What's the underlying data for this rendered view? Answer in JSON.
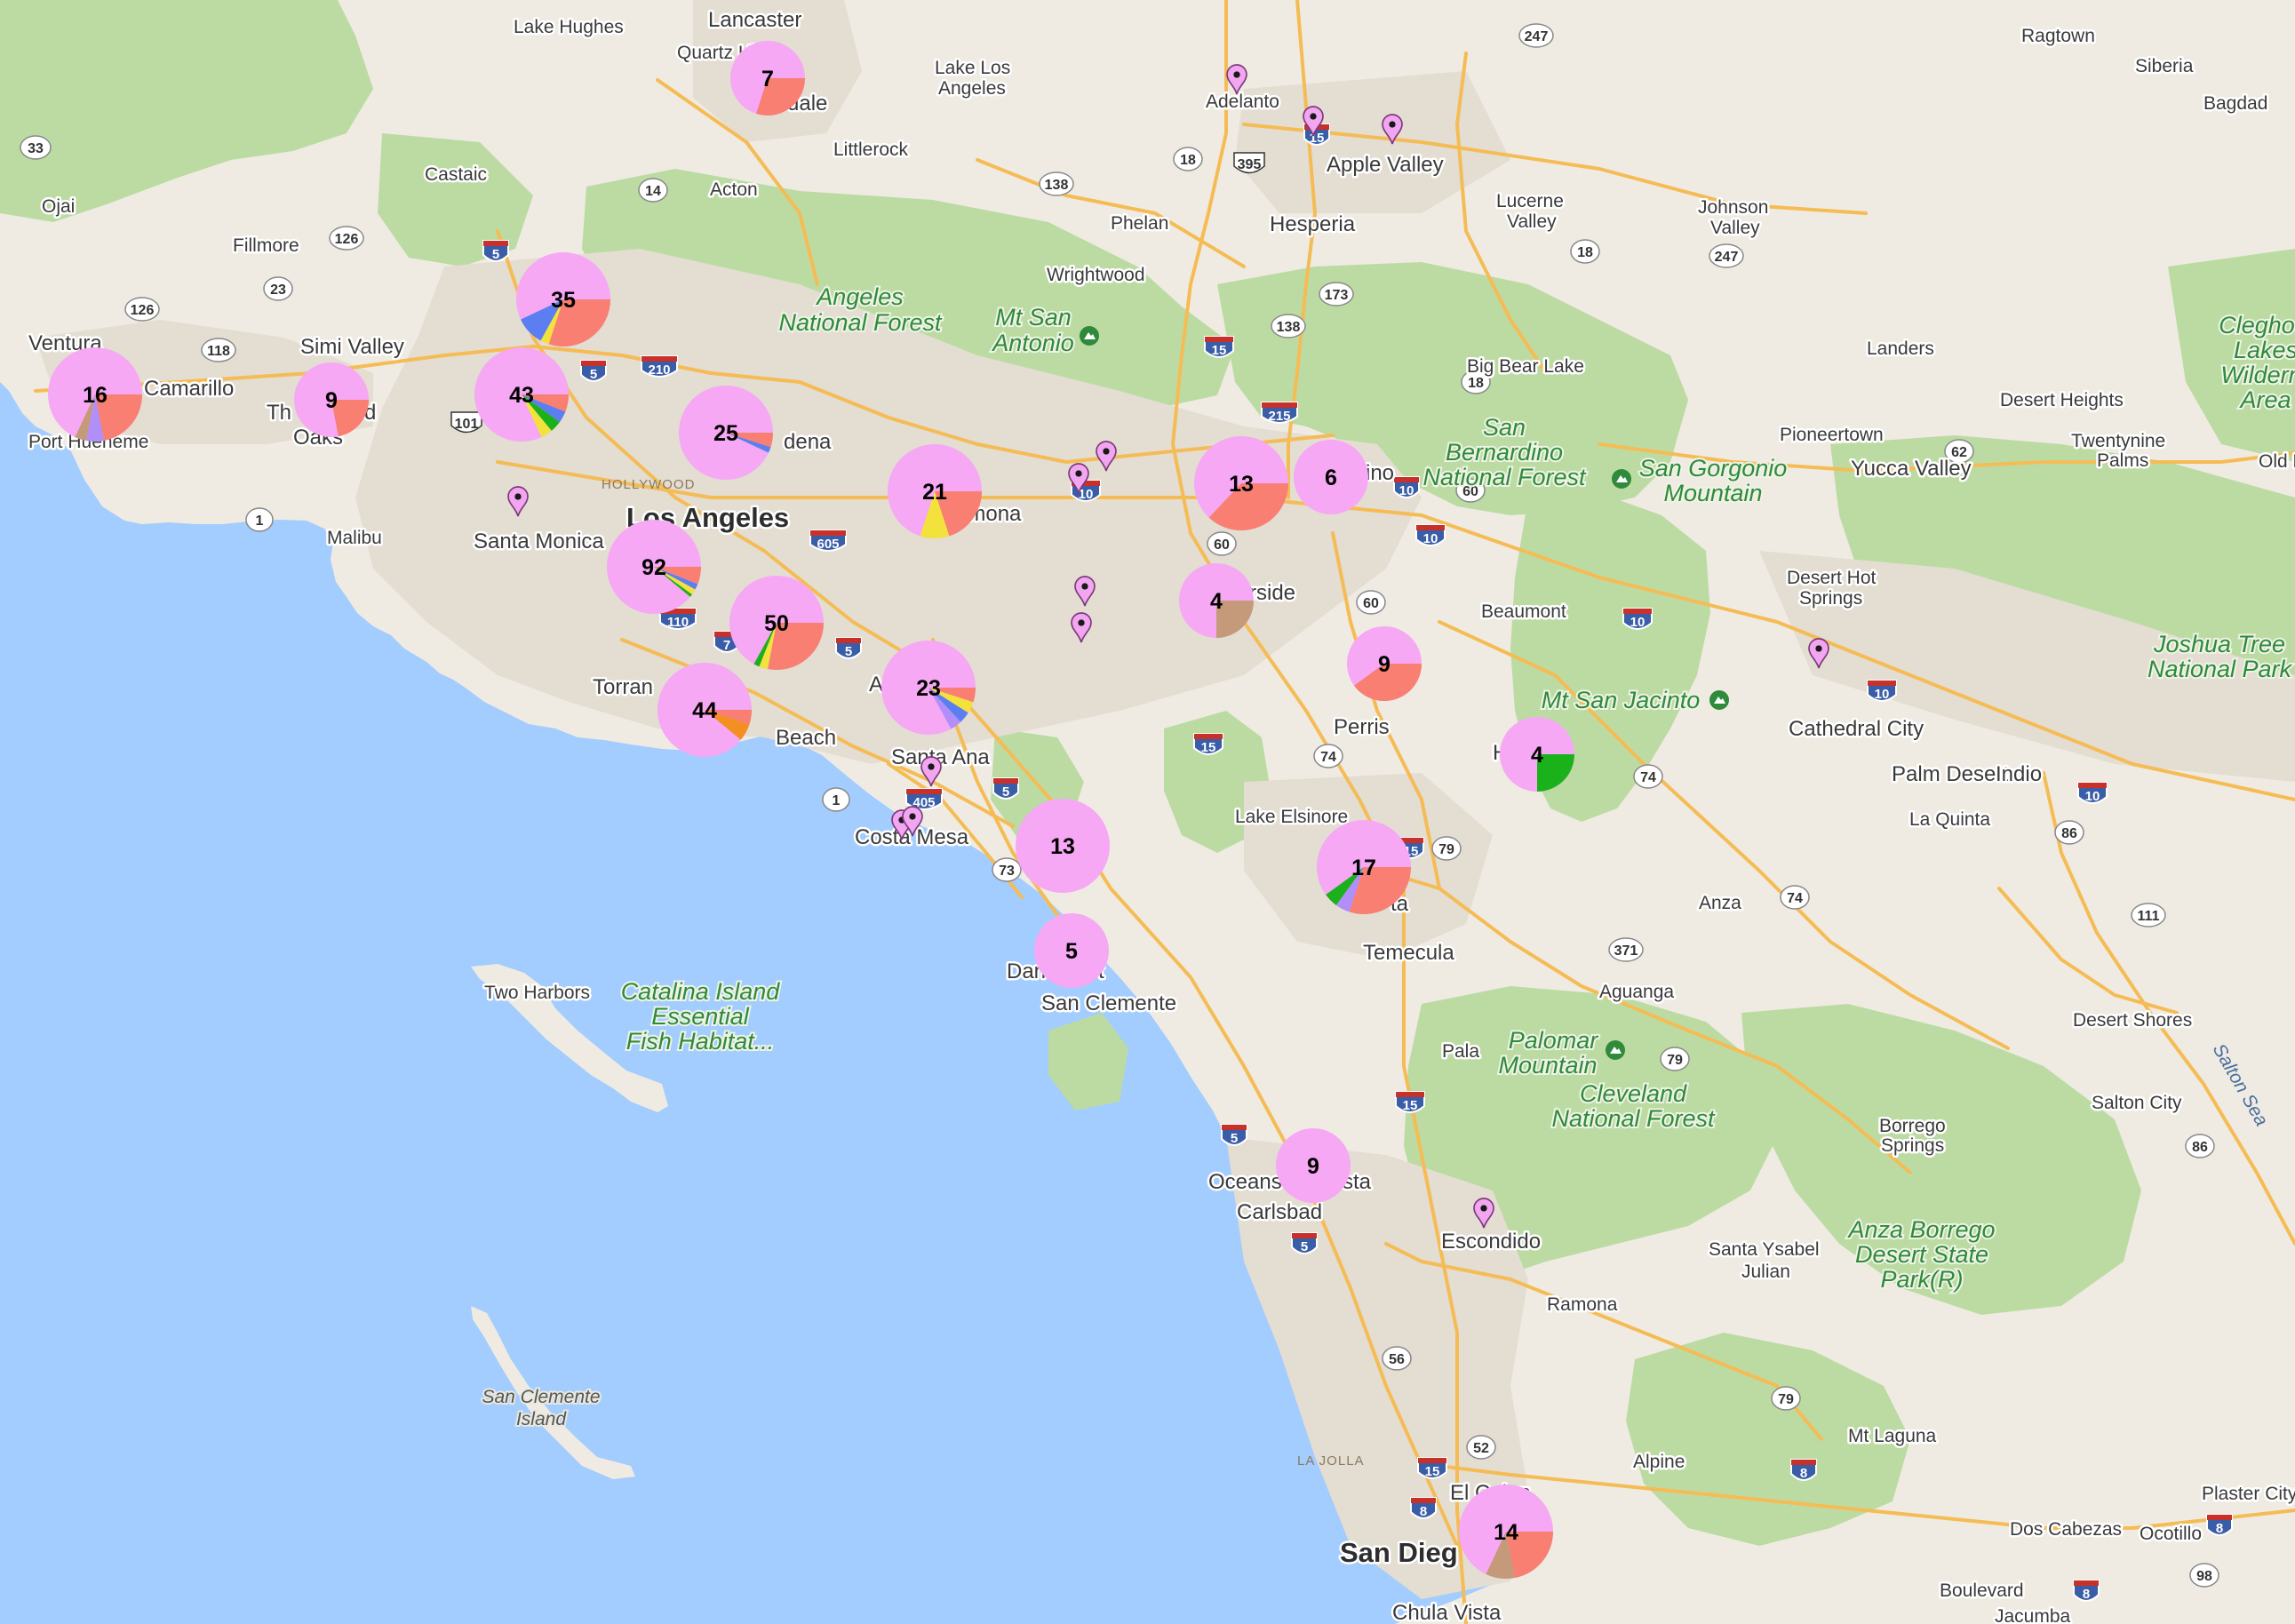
{
  "colors": {
    "water": "#a3ccff",
    "land": "#efebe2",
    "urban": "#e3ddd2",
    "forest": "#bcdba3",
    "highway": "#f5bc55",
    "interstate": "#3a5da8",
    "cluster_base": "#f6a8f4",
    "slice_red": "#f87f71",
    "slice_yellow": "#f4e23c",
    "slice_blue": "#5b7ff0",
    "slice_green": "#1bb11b",
    "slice_purple": "#b18ef8",
    "slice_brown": "#c49a7a",
    "slice_orange": "#f49022",
    "pin": "#f2a5f0"
  },
  "places": {
    "lancaster": "Lancaster",
    "lake_hughes": "Lake Hughes",
    "quartz_hill": "Quartz Hill",
    "palmdale": "dale",
    "lake_los_angeles_1": "Lake Los",
    "lake_los_angeles_2": "Angeles",
    "littlerock": "Littlerock",
    "acton": "Acton",
    "castaic": "Castaic",
    "ojai": "Ojai",
    "fillmore": "Fillmore",
    "ventura": "Ventura",
    "camarillo": "Camarillo",
    "port_hueneme": "Port Hueneme",
    "simi_valley": "Simi Valley",
    "thousand_oaks_a": "Th",
    "thousand_oaks_b": "d",
    "thousand_oaks_c": "Oaks",
    "malibu": "Malibu",
    "santa_monica": "Santa Monica",
    "hollywood": "HOLLYWOOD",
    "los_angeles": "Los Angeles",
    "pasadena": "dena",
    "pomona": "Pomona",
    "torrance": "Torran",
    "long_beach": "Beach",
    "anaheim": "A",
    "santa_ana": "Santa Ana",
    "costa_mesa": "Costa Mesa",
    "dana_point_a": "Dan",
    "dana_point_b": "t",
    "san_clemente": "San Clemente",
    "two_harbors": "Two Harbors",
    "adelanto": "Adelanto",
    "apple_valley": "Apple Valley",
    "hesperia": "Hesperia",
    "phelan": "Phelan",
    "wrightwood": "Wrightwood",
    "lucerne_1": "Lucerne",
    "lucerne_2": "Valley",
    "johnson_1": "Johnson",
    "johnson_2": "Valley",
    "ragtown": "Ragtown",
    "siberia": "Siberia",
    "bagdad": "Bagdad",
    "landers": "Landers",
    "big_bear_lake": "Big Bear Lake",
    "desert_heights": "Desert Heights",
    "pioneertown": "Pioneertown",
    "yucca_valley": "Yucca Valley",
    "twentynine_1": "Twentynine",
    "twentynine_2": "Palms",
    "old_d": "Old D",
    "san_bernardino": "ino",
    "riverside": "rside",
    "beaumont": "Beaumont",
    "desert_hot_1": "Desert Hot",
    "desert_hot_2": "Springs",
    "perris": "Perris",
    "hemet": "H",
    "cathedral_city": "Cathedral City",
    "palm_desert": "Palm Desert",
    "indio": "Indio",
    "la_quinta": "La Quinta",
    "lake_elsinore": "Lake Elsinore",
    "murrieta": "ta",
    "temecula": "Temecula",
    "anza": "Anza",
    "aguanga": "Aguanga",
    "pala": "Pala",
    "oceanside_a": "Oceans",
    "oceanside_b": "sta",
    "carlsbad": "Carlsbad",
    "escondido": "Escondido",
    "santa_ysabel": "Santa Ysabel",
    "julian": "Julian",
    "ramona": "Ramona",
    "borrego_1": "Borrego",
    "borrego_2": "Springs",
    "desert_shores": "Desert Shores",
    "salton_city": "Salton City",
    "la_jolla": "LA JOLLA",
    "san_diego": "San Dieg",
    "el_cajon": "El Cajon",
    "chula_vista": "Chula Vista",
    "alpine": "Alpine",
    "mt_laguna": "Mt Laguna",
    "dos_cabezas": "Dos Cabezas",
    "ocotillo": "Ocotillo",
    "plaster_city": "Plaster City",
    "boulevard": "Boulevard",
    "jacumba": "Jacumba"
  },
  "parks": {
    "angeles_1": "Angeles",
    "angeles_2": "National Forest",
    "mt_san_antonio_1": "Mt San",
    "mt_san_antonio_2": "Antonio",
    "san_bernardino_nf_1": "San",
    "san_bernardino_nf_2": "Bernardino",
    "san_bernardino_nf_3": "National Forest",
    "san_gorgonio_1": "San Gorgonio",
    "san_gorgonio_2": "Mountain",
    "mt_san_jacinto": "Mt San Jacinto",
    "joshua_tree_1": "Joshua Tree",
    "joshua_tree_2": "National Park",
    "clegho_1": "Clegho",
    "clegho_2": "Lakes",
    "clegho_3": "Wildern",
    "clegho_4": "Area",
    "palomar_1": "Palomar",
    "palomar_2": "Mountain",
    "cleveland_1": "Cleveland",
    "cleveland_2": "National Forest",
    "anza_borrego_1": "Anza Borrego",
    "anza_borrego_2": "Desert State",
    "anza_borrego_3": "Park(R)",
    "catalina_1": "Catalina Island",
    "catalina_2": "Essential",
    "catalina_3": "Fish Habitat..."
  },
  "islands": {
    "san_clemente_1": "San Clemente",
    "san_clemente_2": "Island"
  },
  "water_labels": {
    "salton_sea": "Salton Sea"
  },
  "highways": [
    {
      "id": "33",
      "type": "state"
    },
    {
      "id": "126",
      "type": "state"
    },
    {
      "id": "23",
      "type": "state"
    },
    {
      "id": "118",
      "type": "state"
    },
    {
      "id": "101",
      "type": "us"
    },
    {
      "id": "1",
      "type": "state"
    },
    {
      "id": "14",
      "type": "state"
    },
    {
      "id": "138",
      "type": "state"
    },
    {
      "id": "18",
      "type": "state"
    },
    {
      "id": "395",
      "type": "us"
    },
    {
      "id": "247",
      "type": "state"
    },
    {
      "id": "173",
      "type": "state"
    },
    {
      "id": "62",
      "type": "state"
    },
    {
      "id": "60",
      "type": "state"
    },
    {
      "id": "74",
      "type": "state"
    },
    {
      "id": "79",
      "type": "state"
    },
    {
      "id": "371",
      "type": "state"
    },
    {
      "id": "86",
      "type": "state"
    },
    {
      "id": "111",
      "type": "state"
    },
    {
      "id": "73",
      "type": "state"
    },
    {
      "id": "56",
      "type": "state"
    },
    {
      "id": "52",
      "type": "state"
    },
    {
      "id": "98",
      "type": "state"
    },
    {
      "id": "5",
      "type": "interstate"
    },
    {
      "id": "15",
      "type": "interstate"
    },
    {
      "id": "10",
      "type": "interstate"
    },
    {
      "id": "210",
      "type": "interstate"
    },
    {
      "id": "215",
      "type": "interstate"
    },
    {
      "id": "605",
      "type": "interstate"
    },
    {
      "id": "110",
      "type": "interstate"
    },
    {
      "id": "405",
      "type": "interstate"
    },
    {
      "id": "8",
      "type": "interstate"
    }
  ],
  "clusters": [
    {
      "id": "palmdale",
      "count": "7",
      "slices": [
        {
          "color": "slice_red",
          "frac": 0.3
        }
      ]
    },
    {
      "id": "santa-clarita",
      "count": "35",
      "slices": [
        {
          "color": "slice_red",
          "frac": 0.3
        },
        {
          "color": "slice_yellow",
          "frac": 0.03
        },
        {
          "color": "slice_blue",
          "frac": 0.1
        }
      ]
    },
    {
      "id": "ventura",
      "count": "16",
      "slices": [
        {
          "color": "slice_red",
          "frac": 0.22
        },
        {
          "color": "slice_purple",
          "frac": 0.06
        },
        {
          "color": "slice_brown",
          "frac": 0.04
        }
      ]
    },
    {
      "id": "thousand-oaks",
      "count": "9",
      "slices": [
        {
          "color": "slice_red",
          "frac": 0.22
        }
      ]
    },
    {
      "id": "san-fernando-valley",
      "count": "43",
      "slices": [
        {
          "color": "slice_red",
          "frac": 0.06
        },
        {
          "color": "slice_blue",
          "frac": 0.04
        },
        {
          "color": "slice_green",
          "frac": 0.04
        },
        {
          "color": "slice_yellow",
          "frac": 0.04
        }
      ]
    },
    {
      "id": "pasadena",
      "count": "25",
      "slices": [
        {
          "color": "slice_red",
          "frac": 0.05
        },
        {
          "color": "slice_blue",
          "frac": 0.02
        }
      ]
    },
    {
      "id": "los-angeles",
      "count": "92",
      "slices": [
        {
          "color": "slice_red",
          "frac": 0.06
        },
        {
          "color": "slice_blue",
          "frac": 0.02
        },
        {
          "color": "slice_yellow",
          "frac": 0.02
        },
        {
          "color": "slice_green",
          "frac": 0.01
        }
      ]
    },
    {
      "id": "downey",
      "count": "50",
      "slices": [
        {
          "color": "slice_red",
          "frac": 0.28
        },
        {
          "color": "slice_yellow",
          "frac": 0.03
        },
        {
          "color": "slice_green",
          "frac": 0.02
        }
      ]
    },
    {
      "id": "long-beach",
      "count": "44",
      "slices": [
        {
          "color": "slice_red",
          "frac": 0.05
        },
        {
          "color": "slice_orange",
          "frac": 0.06
        }
      ]
    },
    {
      "id": "pomona",
      "count": "21",
      "slices": [
        {
          "color": "slice_red",
          "frac": 0.2
        },
        {
          "color": "slice_yellow",
          "frac": 0.1
        }
      ]
    },
    {
      "id": "anaheim",
      "count": "23",
      "slices": [
        {
          "color": "slice_red",
          "frac": 0.05
        },
        {
          "color": "slice_yellow",
          "frac": 0.04
        },
        {
          "color": "slice_blue",
          "frac": 0.04
        },
        {
          "color": "slice_purple",
          "frac": 0.04
        }
      ]
    },
    {
      "id": "irvine",
      "count": "13",
      "slices": []
    },
    {
      "id": "dana-point",
      "count": "5",
      "slices": []
    },
    {
      "id": "san-bernardino-west",
      "count": "13",
      "slices": [
        {
          "color": "slice_red",
          "frac": 0.37
        }
      ]
    },
    {
      "id": "san-bernardino",
      "count": "6",
      "slices": []
    },
    {
      "id": "riverside",
      "count": "4",
      "slices": [
        {
          "color": "slice_brown",
          "frac": 0.25
        }
      ]
    },
    {
      "id": "perris",
      "count": "9",
      "slices": [
        {
          "color": "slice_red",
          "frac": 0.4
        }
      ]
    },
    {
      "id": "hemet",
      "count": "4",
      "slices": [
        {
          "color": "slice_green",
          "frac": 0.25
        }
      ]
    },
    {
      "id": "murrieta",
      "count": "17",
      "slices": [
        {
          "color": "slice_red",
          "frac": 0.3
        },
        {
          "color": "slice_purple",
          "frac": 0.05
        },
        {
          "color": "slice_green",
          "frac": 0.05
        }
      ]
    },
    {
      "id": "oceanside",
      "count": "9",
      "slices": []
    },
    {
      "id": "san-diego",
      "count": "14",
      "slices": [
        {
          "color": "slice_red",
          "frac": 0.22
        },
        {
          "color": "slice_brown",
          "frac": 0.1
        }
      ]
    }
  ],
  "pins": [
    "adelanto",
    "victorville",
    "apple-valley",
    "santa-monica-mtn",
    "rancho-cucamonga-1",
    "rancho-cucamonga-2",
    "chino-1",
    "chino-2",
    "santa-ana",
    "costa-mesa-1",
    "costa-mesa-2",
    "desert-hot-springs",
    "escondido"
  ]
}
